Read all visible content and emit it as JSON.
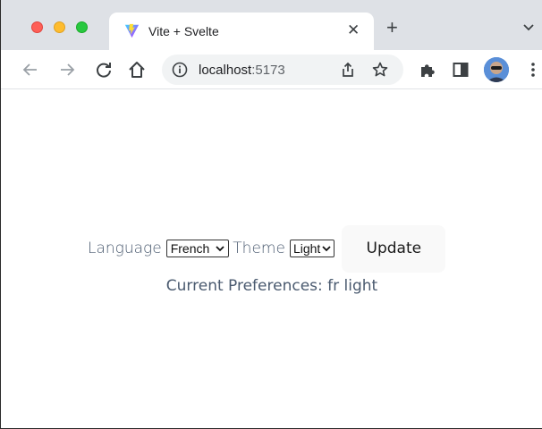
{
  "window": {
    "traffic_lights": {
      "close": "#fe5f57",
      "minimize": "#febc2e",
      "maximize": "#28c840"
    }
  },
  "tab": {
    "title": "Vite + Svelte",
    "favicon": "vite-icon",
    "close_icon": "close-icon"
  },
  "toolbar": {
    "back_icon": "back-arrow-icon",
    "forward_icon": "forward-arrow-icon",
    "reload_icon": "reload-icon",
    "home_icon": "home-icon",
    "address": {
      "host": "localhost",
      "port": ":5173"
    },
    "share_icon": "share-icon",
    "bookmark_icon": "star-icon",
    "extensions_icon": "puzzle-icon",
    "sidepanel_icon": "side-panel-icon",
    "menu_icon": "kebab-menu-icon"
  },
  "page": {
    "language_label": "Language",
    "language_value": "French",
    "theme_label": "Theme",
    "theme_value": "Light",
    "update_label": "Update",
    "current_preferences": "Current Preferences: fr light"
  },
  "colors": {
    "text": "#4a5a6f",
    "button_bg": "#f9f9f9",
    "tabstrip": "#dee1e6"
  }
}
